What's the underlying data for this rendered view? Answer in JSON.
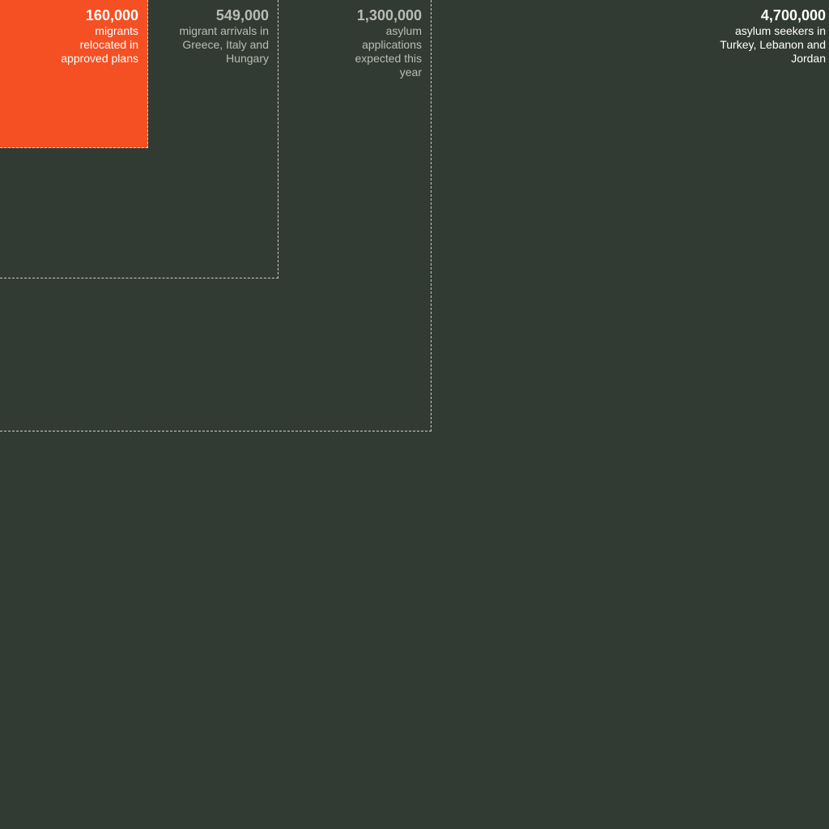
{
  "chart_data": {
    "type": "nested-squares",
    "title": "",
    "items": [
      {
        "value": 4700000,
        "value_label": "4,700,000",
        "description": "asylum seekers in Turkey, Lebanon and Jordan",
        "style": "background",
        "text_color": "#ffffff"
      },
      {
        "value": 1300000,
        "value_label": "1,300,000",
        "description": "asylum applications expected this year",
        "style": "outline",
        "text_color": "#b9bcb6"
      },
      {
        "value": 549000,
        "value_label": "549,000",
        "description": "migrant arrivals in Greece, Italy and Hungary",
        "style": "outline",
        "text_color": "#b9bcb6"
      },
      {
        "value": 160000,
        "value_label": "160,000",
        "description": "migrants relocated in approved plans",
        "style": "filled",
        "fill_color": "#f55024",
        "text_color": "#ffffff"
      }
    ],
    "colors": {
      "background": "#323b33",
      "highlight": "#f55024",
      "outline": "#c9cbc5"
    }
  }
}
